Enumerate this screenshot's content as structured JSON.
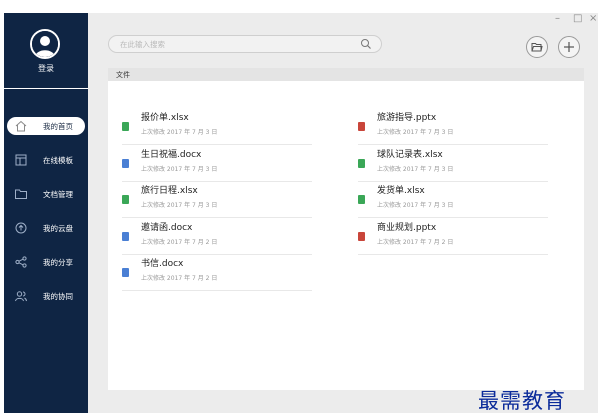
{
  "sidebar": {
    "login_label": "登录",
    "items": [
      {
        "label": "我的首页",
        "icon": "home-icon",
        "active": true
      },
      {
        "label": "在线模板",
        "icon": "template-icon",
        "active": false
      },
      {
        "label": "文档管理",
        "icon": "folder-icon",
        "active": false
      },
      {
        "label": "我的云盘",
        "icon": "cloud-upload-icon",
        "active": false
      },
      {
        "label": "我的分享",
        "icon": "share-icon",
        "active": false
      },
      {
        "label": "我的协同",
        "icon": "collaborators-icon",
        "active": false
      }
    ]
  },
  "window": {
    "minimize": "–",
    "maximize": "□",
    "close": "×"
  },
  "search": {
    "placeholder": "在此输入搜索",
    "icon": "search-icon"
  },
  "toolbar": {
    "open_folder_icon": "folder-open-icon",
    "add_icon": "plus-icon"
  },
  "panel": {
    "header": "文件"
  },
  "files": [
    {
      "name": "报价单.xlsx",
      "date": "上次修改 2017 年 7 月 3 日",
      "type": "xlsx"
    },
    {
      "name": "旅游指导.pptx",
      "date": "上次修改 2017 年 7 月 3 日",
      "type": "pptx"
    },
    {
      "name": "生日祝福.docx",
      "date": "上次修改 2017 年 7 月 3 日",
      "type": "docx"
    },
    {
      "name": "球队记录表.xlsx",
      "date": "上次修改 2017 年 7 月 3 日",
      "type": "xlsx"
    },
    {
      "name": "旅行日程.xlsx",
      "date": "上次修改 2017 年 7 月 3 日",
      "type": "xlsx"
    },
    {
      "name": "发货单.xlsx",
      "date": "上次修改 2017 年 7 月 3 日",
      "type": "xlsx"
    },
    {
      "name": "邀请函.docx",
      "date": "上次修改 2017 年 7 月 2 日",
      "type": "docx"
    },
    {
      "name": "商业规划.pptx",
      "date": "上次修改 2017 年 7 月 2 日",
      "type": "pptx"
    },
    {
      "name": "书信.docx",
      "date": "上次修改 2017 年 7 月 2 日",
      "type": "docx"
    }
  ],
  "colors": {
    "sidebar_bg": "#0f2544",
    "xlsx": "#3aa757",
    "docx": "#4a7fd4",
    "pptx": "#c9453a",
    "watermark": "#0b2b9a"
  },
  "watermark": "最需教育"
}
